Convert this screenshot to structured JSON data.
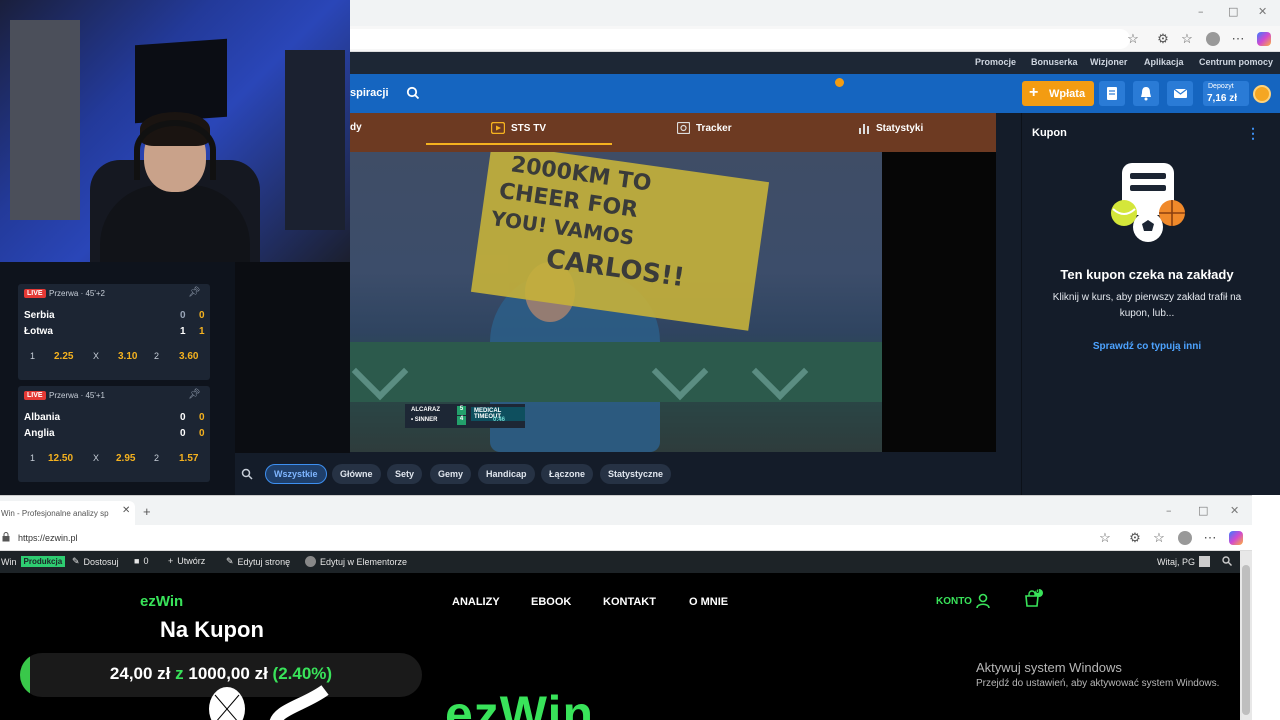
{
  "sts": {
    "top_links": [
      "Promocje",
      "Bonuserka",
      "Wizjoner",
      "Aplikacja",
      "Centrum pomocy"
    ],
    "nav_partial": "spiracji",
    "deposit_button": "Wpłata",
    "notification_count": "1",
    "depozyt_label": "Depozyt",
    "depozyt_value": "7,16 zł",
    "tv_tabs": {
      "partial_left": "dy",
      "sts_tv": "STS TV",
      "tracker": "Tracker",
      "statystyki": "Statystyki"
    },
    "scorebug": {
      "player1": "ALCARAZ",
      "player2": "• SINNER",
      "score1": "5",
      "score2": "4",
      "status": "MEDICAL TIMEOUT",
      "time": "0:46"
    },
    "sign_text": [
      "2000KM TO",
      "CHEER FOR",
      "YOU! VAMOS",
      "CARLOS!!"
    ],
    "market_chips": [
      "Wszystkie",
      "Główne",
      "Sety",
      "Gemy",
      "Handicap",
      "Łączone",
      "Statystyczne"
    ],
    "kupon": {
      "title": "Kupon",
      "heading": "Ten kupon czeka na zakłady",
      "description": "Kliknij w kurs, aby pierwszy zakład trafił na kupon, lub...",
      "link": "Sprawdź co typują inni"
    },
    "matches": [
      {
        "live": "LIVE",
        "status": "Przerwa · 45'+2",
        "team1": "Serbia",
        "team2": "Łotwa",
        "score1a": "0",
        "score1b": "0",
        "score2a": "1",
        "score2b": "1",
        "odds": [
          {
            "k": "1",
            "v": "2.25"
          },
          {
            "k": "X",
            "v": "3.10"
          },
          {
            "k": "2",
            "v": "3.60"
          }
        ]
      },
      {
        "live": "LIVE",
        "status": "Przerwa · 45'+1",
        "team1": "Albania",
        "team2": "Anglia",
        "score1a": "0",
        "score1b": "0",
        "score2a": "0",
        "score2b": "0",
        "odds": [
          {
            "k": "1",
            "v": "12.50"
          },
          {
            "k": "X",
            "v": "2.95"
          },
          {
            "k": "2",
            "v": "1.57"
          }
        ]
      }
    ]
  },
  "ezwin_browser": {
    "tab_title": "Win - Profesjonalne analizy sp",
    "url": "https://ezwin.pl",
    "admin_bar": {
      "site": "Win",
      "badge": "Produkcja",
      "customize": "Dostosuj",
      "comments": "0",
      "create": "Utwórz",
      "edit_page": "Edytuj stronę",
      "edit_elementor": "Edytuj w Elementorze",
      "greeting": "Witaj, PG"
    },
    "site": {
      "logo": "ezWin",
      "menu": [
        "ANALIZY",
        "EBOOK",
        "KONTAKT",
        "O MNIE"
      ],
      "konto": "KONTO",
      "cart_count": "0",
      "title": "Na Kupon",
      "progress": {
        "current": "24,00 zł",
        "connector": "z",
        "target": "1000,00 zł",
        "percent_label": "(2.40%)",
        "fraction": 0.024
      },
      "hero_word": "ezWin"
    },
    "windows_notice": {
      "title": "Aktywuj system Windows",
      "subtitle": "Przejdź do ustawień, aby aktywować system Windows."
    }
  },
  "colors": {
    "sts_blue": "#1565c0",
    "sts_orange": "#f39c12",
    "odds_yellow": "#f5b21f",
    "ez_green": "#39e35a",
    "live_red": "#e53935"
  }
}
